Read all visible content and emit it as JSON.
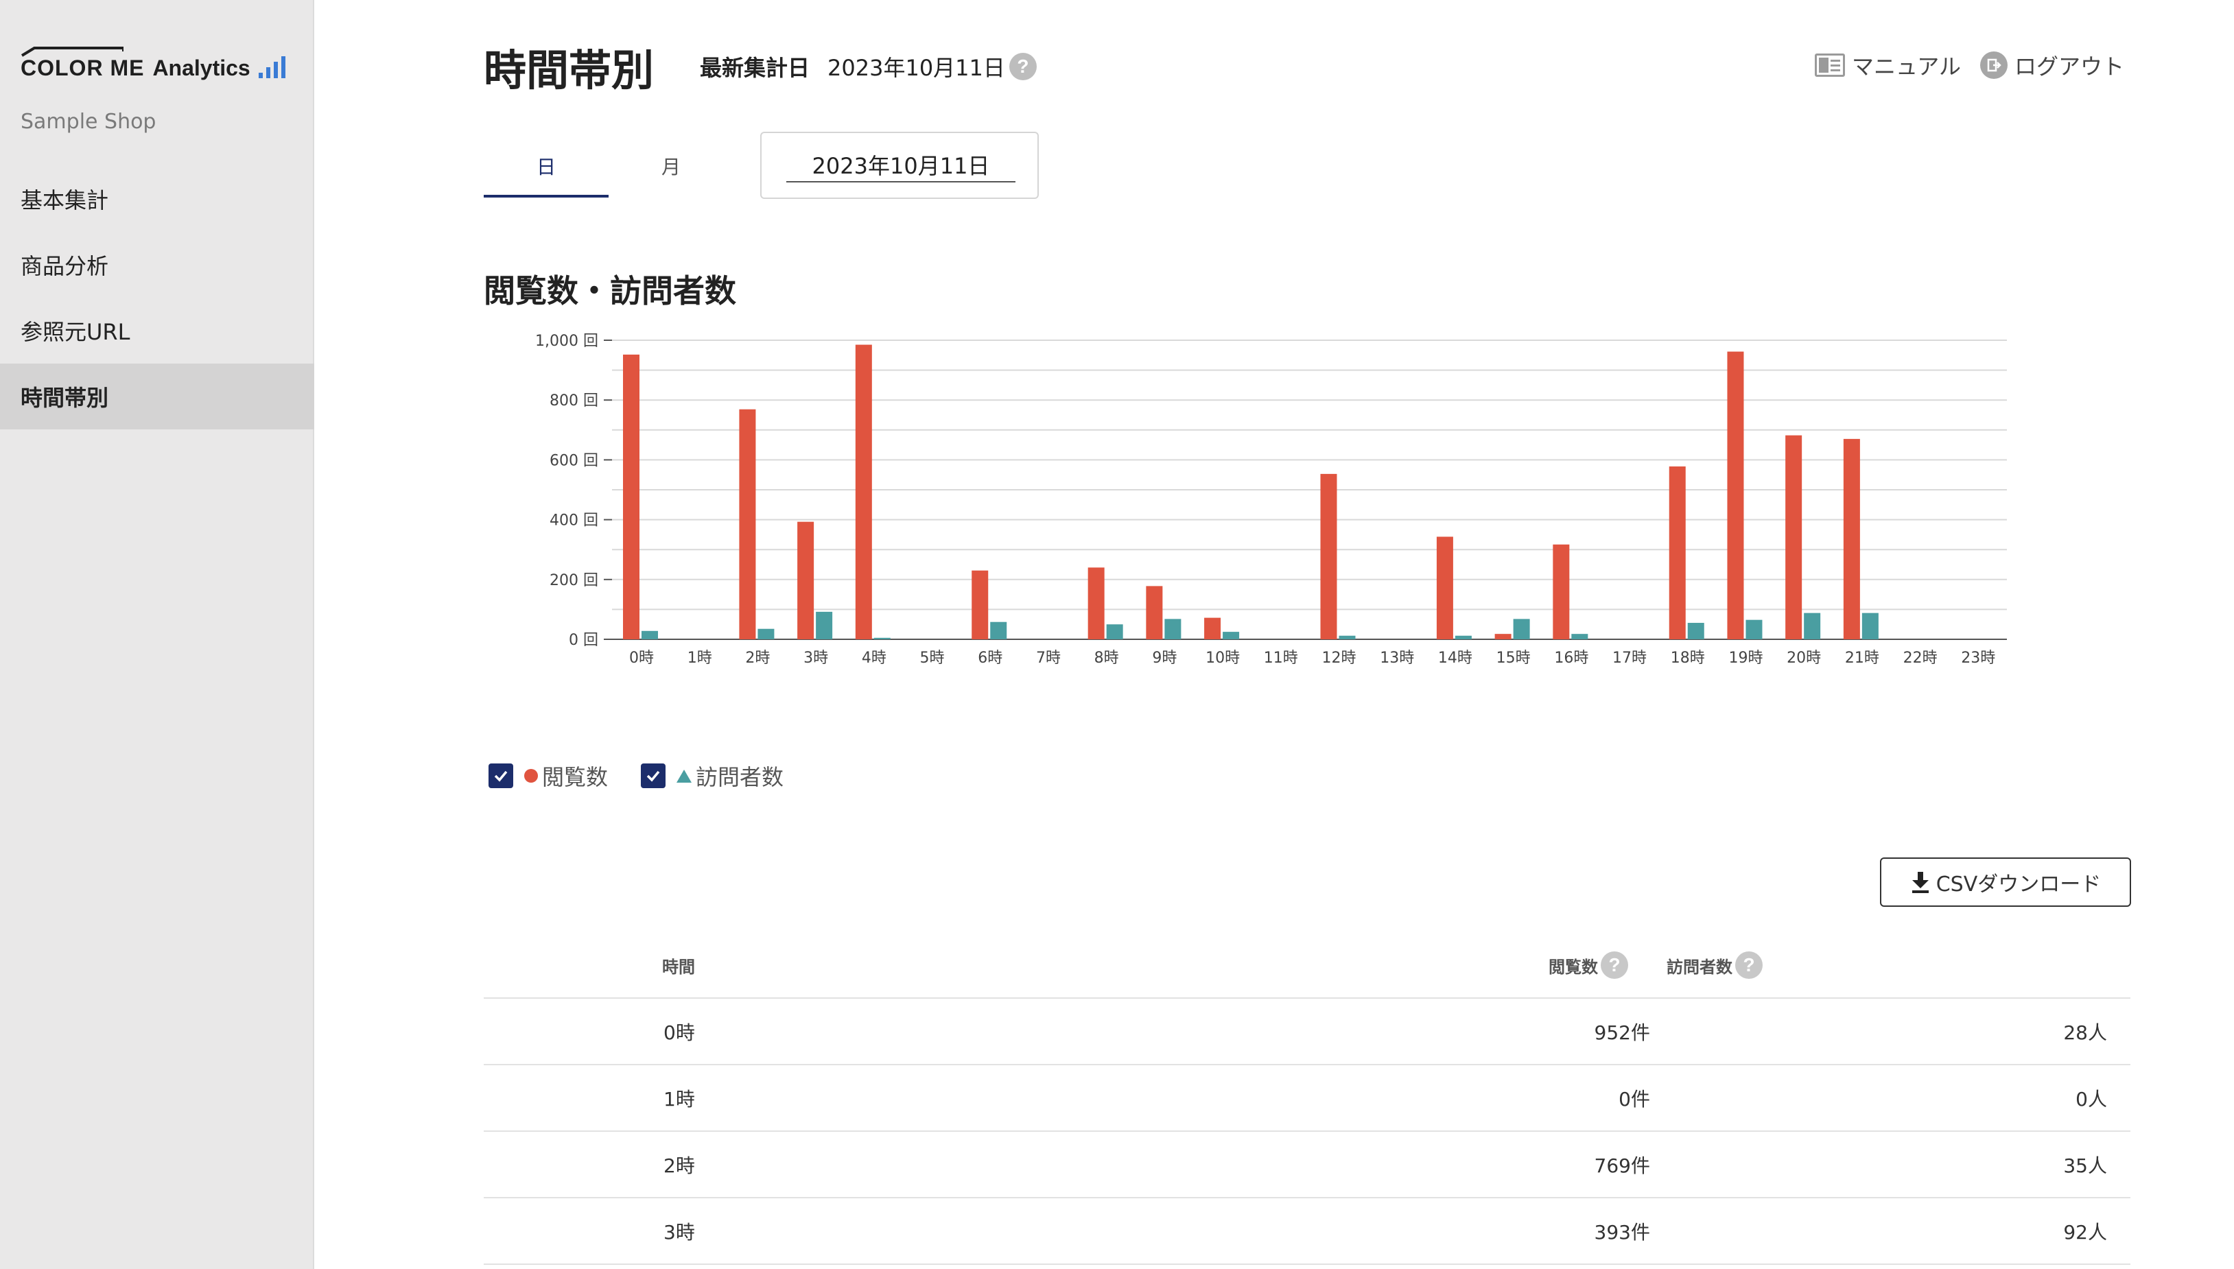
{
  "app": {
    "logo_text_1": "COLOR ME",
    "logo_text_2": "Analytics",
    "shop_name": "Sample Shop"
  },
  "sidebar": {
    "items": [
      {
        "label": "基本集計",
        "active": false
      },
      {
        "label": "商品分析",
        "active": false
      },
      {
        "label": "参照元URL",
        "active": false
      },
      {
        "label": "時間帯別",
        "active": true
      }
    ]
  },
  "header": {
    "title": "時間帯別",
    "latest_label": "最新集計日",
    "latest_date": "2023年10月11日",
    "help_glyph": "?",
    "manual_label": "マニュアル",
    "logout_label": "ログアウト"
  },
  "tabs": [
    {
      "label": "日",
      "active": true
    },
    {
      "label": "月",
      "active": false
    }
  ],
  "date_picker": {
    "value": "2023年10月11日"
  },
  "section": {
    "title": "閲覧数・訪問者数"
  },
  "colors": {
    "views": "#e0543f",
    "visitors": "#4a9ea1",
    "accent": "#1c2d6b"
  },
  "chart_data": {
    "type": "bar",
    "categories": [
      "0時",
      "1時",
      "2時",
      "3時",
      "4時",
      "5時",
      "6時",
      "7時",
      "8時",
      "9時",
      "10時",
      "11時",
      "12時",
      "13時",
      "14時",
      "15時",
      "16時",
      "17時",
      "18時",
      "19時",
      "20時",
      "21時",
      "22時",
      "23時"
    ],
    "series": [
      {
        "name": "閲覧数",
        "values": [
          952,
          0,
          769,
          393,
          985,
          0,
          230,
          0,
          240,
          178,
          72,
          0,
          553,
          0,
          343,
          18,
          317,
          0,
          578,
          962,
          682,
          670,
          0,
          0
        ]
      },
      {
        "name": "訪問者数",
        "values": [
          28,
          0,
          35,
          92,
          5,
          0,
          58,
          0,
          50,
          68,
          25,
          0,
          12,
          0,
          12,
          68,
          18,
          0,
          55,
          65,
          88,
          88,
          0,
          0
        ]
      }
    ],
    "y_ticks": [
      "0 回",
      "200 回",
      "400 回",
      "600 回",
      "800 回",
      "1,000 回"
    ],
    "ylim": [
      0,
      1000
    ],
    "grid": true
  },
  "legend": [
    {
      "label": "閲覧数",
      "checked": true,
      "marker": "circle"
    },
    {
      "label": "訪問者数",
      "checked": true,
      "marker": "triangle"
    }
  ],
  "csv_button": {
    "label": "CSVダウンロード"
  },
  "table": {
    "headers": {
      "time": "時間",
      "views": "閲覧数",
      "visitors": "訪問者数"
    },
    "rows": [
      {
        "time": "0時",
        "views": "952件",
        "visitors": "28人"
      },
      {
        "time": "1時",
        "views": "0件",
        "visitors": "0人"
      },
      {
        "time": "2時",
        "views": "769件",
        "visitors": "35人"
      },
      {
        "time": "3時",
        "views": "393件",
        "visitors": "92人"
      }
    ]
  }
}
